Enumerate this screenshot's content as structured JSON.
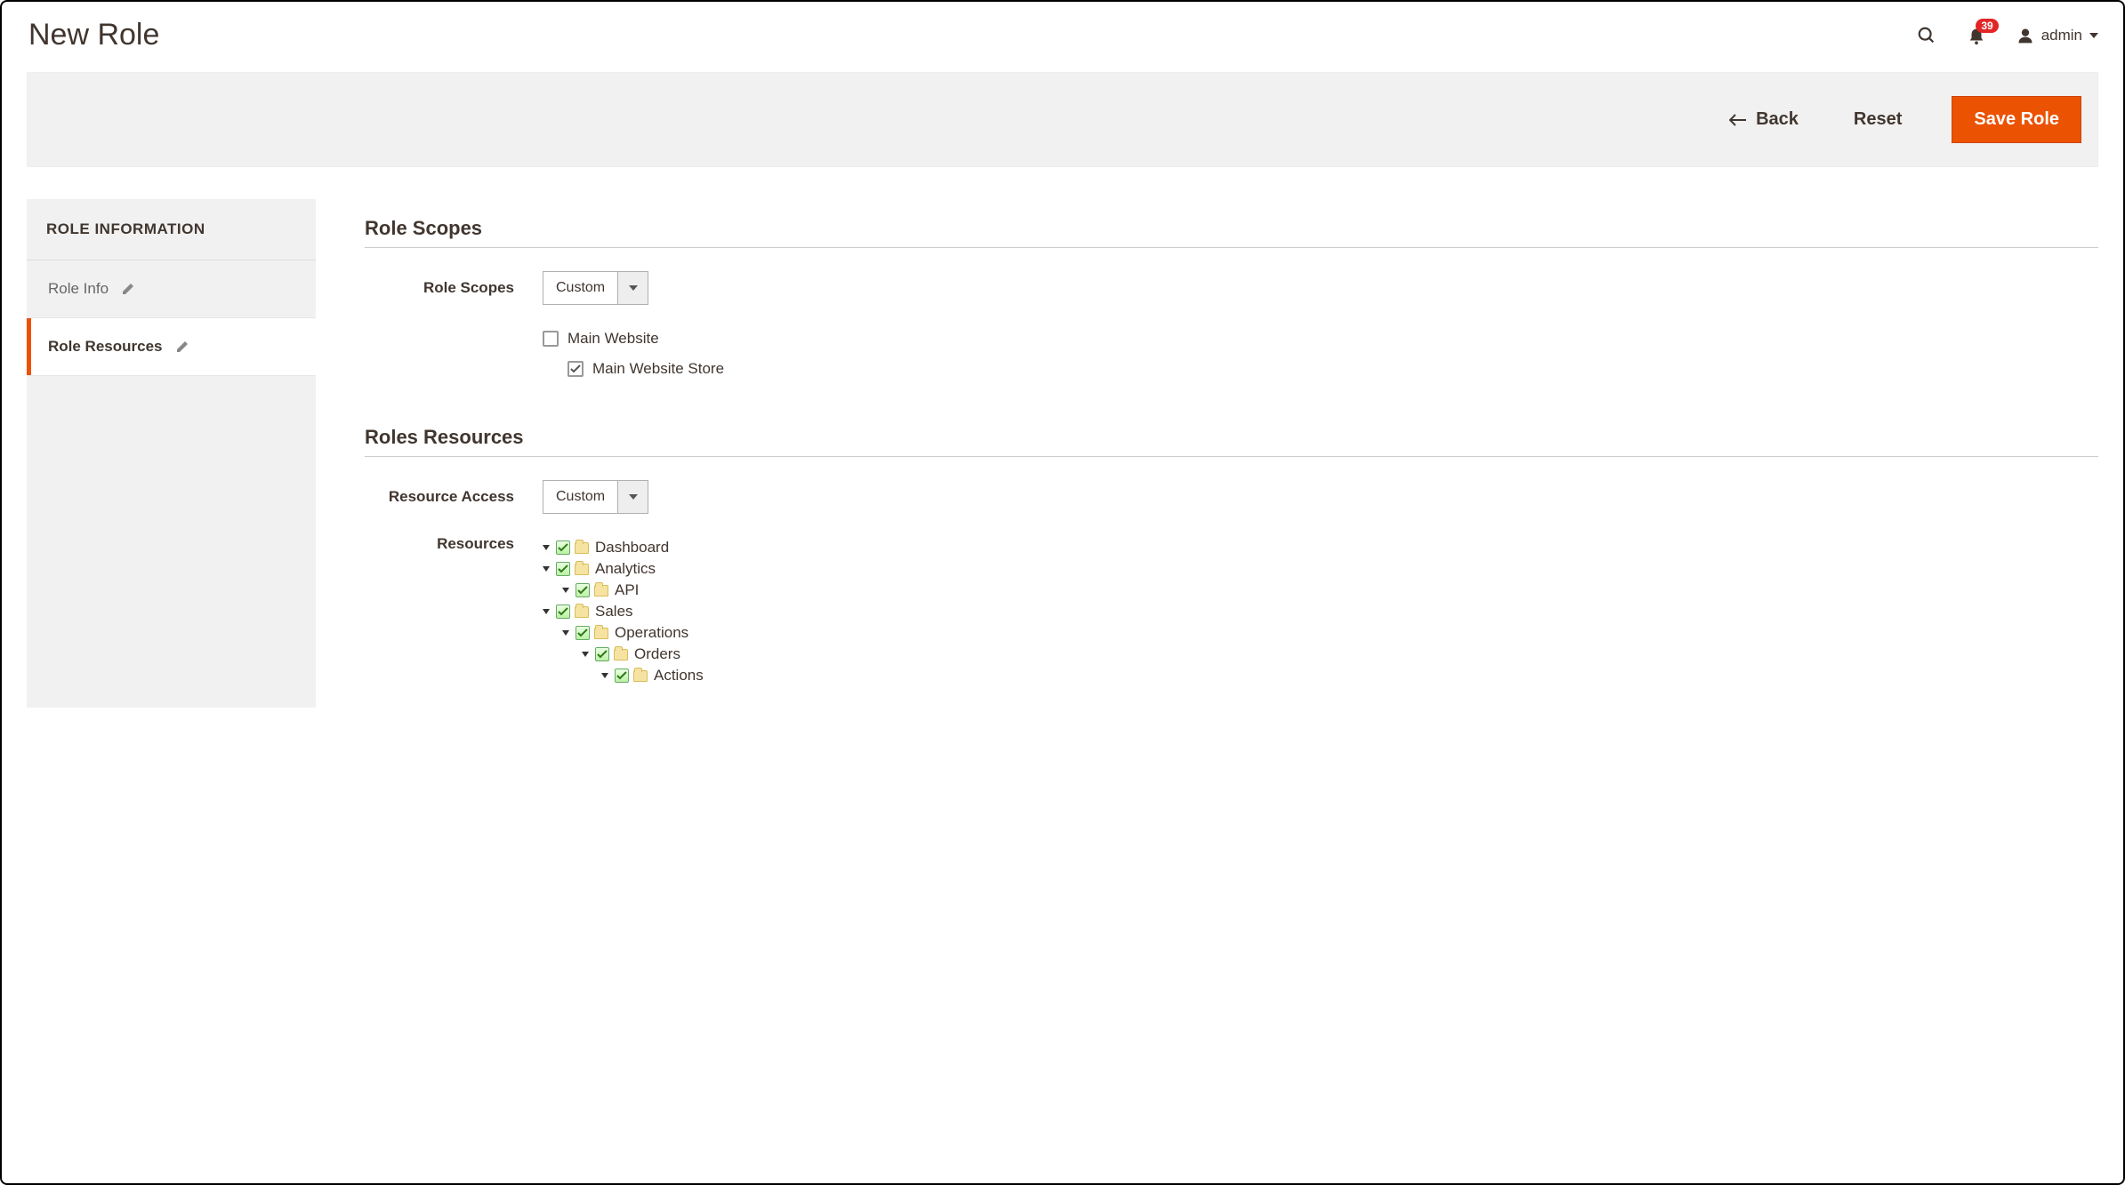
{
  "header": {
    "title": "New Role",
    "notification_count": "39",
    "account_label": "admin"
  },
  "actions": {
    "back": "Back",
    "reset": "Reset",
    "save": "Save Role"
  },
  "sidebar": {
    "heading": "ROLE INFORMATION",
    "items": [
      {
        "label": "Role Info",
        "active": false
      },
      {
        "label": "Role Resources",
        "active": true
      }
    ]
  },
  "scopes": {
    "section_title": "Role Scopes",
    "field_label": "Role Scopes",
    "select_value": "Custom",
    "websites": [
      {
        "label": "Main Website",
        "checked": false
      },
      {
        "label": "Main Website Store",
        "checked": true
      }
    ]
  },
  "resources": {
    "section_title": "Roles Resources",
    "access_label": "Resource Access",
    "access_value": "Custom",
    "tree_label": "Resources",
    "tree": [
      {
        "label": "Dashboard",
        "indent": 0
      },
      {
        "label": "Analytics",
        "indent": 0
      },
      {
        "label": "API",
        "indent": 1
      },
      {
        "label": "Sales",
        "indent": 0
      },
      {
        "label": "Operations",
        "indent": 1
      },
      {
        "label": "Orders",
        "indent": 2
      },
      {
        "label": "Actions",
        "indent": 3
      }
    ]
  }
}
